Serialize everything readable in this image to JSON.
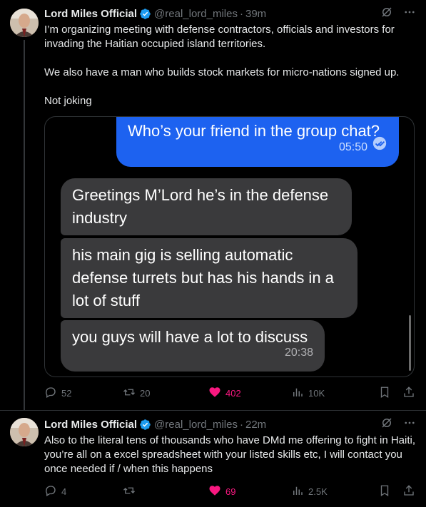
{
  "tweet1": {
    "author_name": "Lord Miles Official",
    "handle": "@real_lord_miles",
    "separator": "·",
    "time": "39m",
    "paragraphs": [
      "I’m organizing meeting with defense contractors, officials and investors for invading the Haitian occupied island territories.",
      "We also have a man who builds stock markets for micro-nations signed up.",
      "Not joking"
    ],
    "media": {
      "outgoing_message": "Who’s your friend in the group chat?",
      "outgoing_time": "05:50",
      "incoming_messages": [
        "Greetings M’Lord he’s in the defense industry",
        "his main gig is selling automatic defense turrets but has his hands in a lot of stuff",
        "you guys will have a lot to discuss"
      ],
      "incoming_time": "20:38"
    },
    "actions": {
      "replies": "52",
      "reposts": "20",
      "likes": "402",
      "views": "10K"
    }
  },
  "tweet2": {
    "author_name": "Lord Miles Official",
    "handle": "@real_lord_miles",
    "separator": "·",
    "time": "22m",
    "text": "Also to the literal tens of thousands who have DMd me offering to fight in Haiti, you’re all on a excel spreadsheet with your listed skills etc, I will contact you once needed if / when this happens",
    "actions": {
      "replies": "4",
      "reposts": "",
      "likes": "69",
      "views": "2.5K"
    }
  },
  "colors": {
    "background": "#000000",
    "text": "#e7e9ea",
    "muted": "#71767b",
    "verified": "#1d9bf0",
    "like": "#f91880",
    "outgoing_bubble": "#1d62f0",
    "incoming_bubble": "#3a3a3c"
  },
  "icons": [
    "verified-badge-icon",
    "grok-icon",
    "more-icon",
    "reply-icon",
    "repost-icon",
    "like-icon",
    "views-icon",
    "bookmark-icon",
    "share-icon",
    "read-receipt-icon"
  ]
}
